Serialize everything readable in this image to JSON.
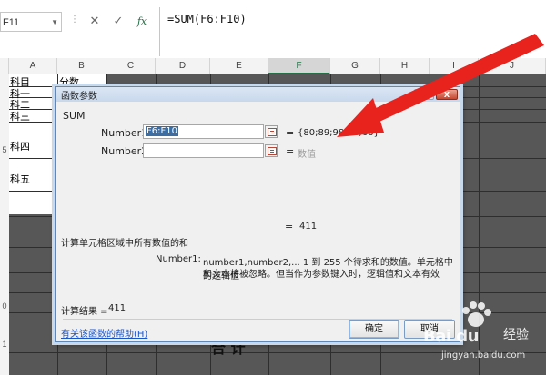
{
  "formula_bar": {
    "name_box": "F11",
    "cancel_glyph": "✕",
    "enter_glyph": "✓",
    "fx_label": "fx",
    "formula": "=SUM(F6:F10)"
  },
  "columns": [
    "A",
    "B",
    "C",
    "D",
    "E",
    "F",
    "G",
    "H",
    "I",
    "J"
  ],
  "rows": [
    "",
    "",
    "",
    "",
    "",
    "5",
    "",
    "",
    "",
    "",
    "",
    "",
    "",
    "",
    "",
    "",
    "",
    "",
    "0",
    "",
    "1",
    ""
  ],
  "cells": {
    "header_a": "科目",
    "header_b": "分数",
    "a_row1": "科一",
    "a_row2": "科二",
    "a_row3": "科三",
    "a_row4": "科四",
    "a_row5": "科五",
    "partial_bottom": "合 计"
  },
  "dialog": {
    "title": "函数参数",
    "help_btn": "?",
    "close_btn": "X",
    "function": "SUM",
    "args": [
      {
        "label": "Number1",
        "value": "F6:F10",
        "result": "{80;89;98;78;66}"
      },
      {
        "label": "Number2",
        "value": "",
        "result": "数值"
      }
    ],
    "formula_result_line": "411",
    "description": "计算单元格区域中所有数值的和",
    "arg_help_name": "Number1:",
    "arg_help_line1": "number1,number2,...  1 到 255 个待求和的数值。单元格中的逻辑值",
    "arg_help_line2": "和文本将被忽略。但当作为参数键入时，逻辑值和文本有效",
    "calc_result_label": "计算结果 =",
    "calc_result_value": "411",
    "help_link": "有关该函数的帮助(H)",
    "ok": "确定",
    "cancel": "取消"
  },
  "watermark": {
    "brand": "Bai du",
    "jingyan": "经验",
    "url": "jingyan.baidu.com"
  },
  "colors": {
    "accent_green": "#217346",
    "arrow_red": "#e8231e",
    "dialog_border": "#5f87b8",
    "link_blue": "#1a55c8"
  }
}
